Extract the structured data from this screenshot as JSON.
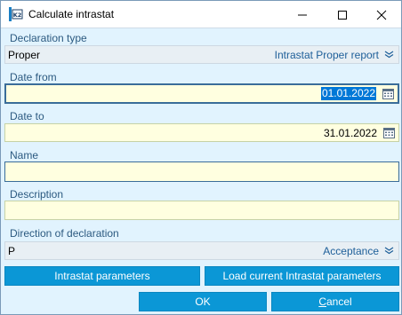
{
  "window": {
    "title": "Calculate intrastat",
    "app_icon_text": "K2"
  },
  "declaration_type": {
    "label": "Declaration type",
    "value": "Proper",
    "option": "Intrastat Proper report"
  },
  "date_from": {
    "label": "Date from",
    "value": "01.01.2022"
  },
  "date_to": {
    "label": "Date to",
    "value": "31.01.2022"
  },
  "name": {
    "label": "Name",
    "value": ""
  },
  "description": {
    "label": "Description",
    "value": ""
  },
  "direction": {
    "label": "Direction of declaration",
    "value": "P",
    "option": "Acceptance"
  },
  "buttons": {
    "intrastat_parameters": "Intrastat parameters",
    "load_parameters": "Load current Intrastat parameters",
    "ok": "OK",
    "cancel_first": "C",
    "cancel_rest": "ancel"
  },
  "colors": {
    "background": "#e1f3fe",
    "field_bg": "#ffffe0",
    "button_bg": "#0b97d6",
    "label_color": "#2c5a80",
    "accent_text": "#1e5f99"
  }
}
